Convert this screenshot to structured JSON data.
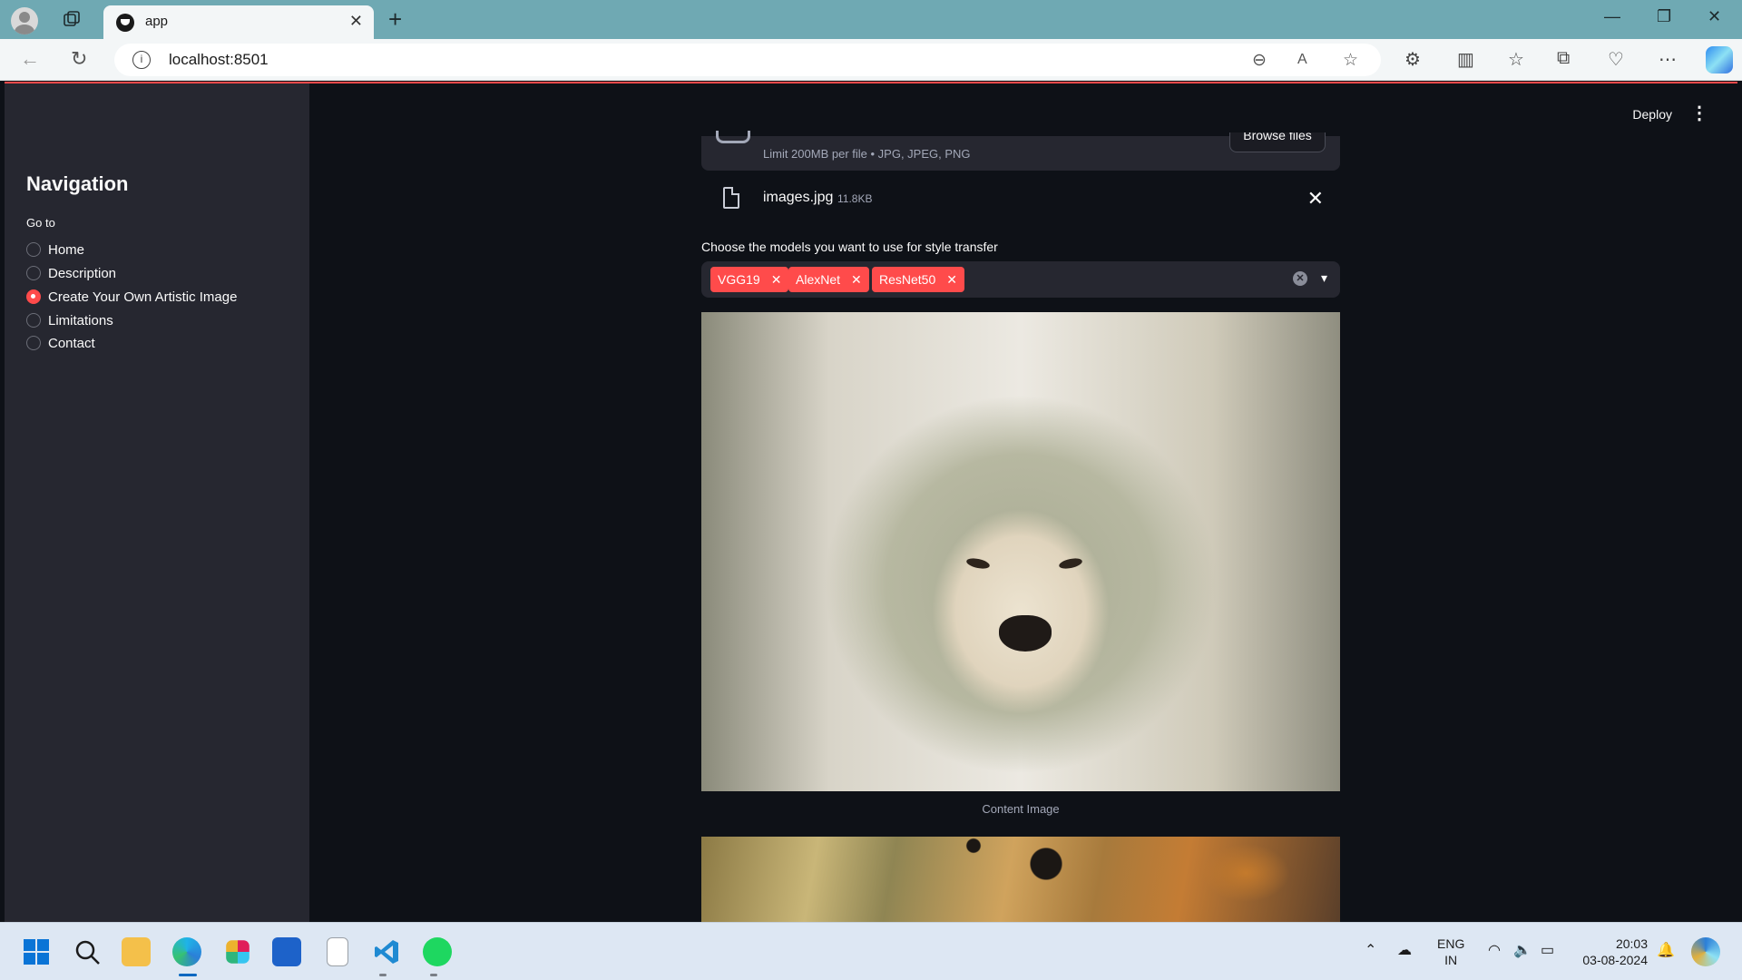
{
  "browser": {
    "tab_title": "app",
    "url": "localhost:8501"
  },
  "sidebar": {
    "title": "Navigation",
    "radio_label": "Go to",
    "options": [
      {
        "label": "Home",
        "selected": false
      },
      {
        "label": "Description",
        "selected": false
      },
      {
        "label": "Create Your Own Artistic Image",
        "selected": true
      },
      {
        "label": "Limitations",
        "selected": false
      },
      {
        "label": "Contact",
        "selected": false
      }
    ]
  },
  "header": {
    "deploy_label": "Deploy",
    "menu_glyph": "⋮"
  },
  "uploader": {
    "limit_text": "Limit 200MB per file • JPG, JPEG, PNG",
    "browse_label": "Browse files",
    "file_name": "images.jpg",
    "file_size": "11.8KB"
  },
  "models": {
    "label": "Choose the models you want to use for style transfer",
    "selected": [
      "VGG19",
      "AlexNet",
      "ResNet50"
    ]
  },
  "content_image": {
    "caption": "Content Image"
  },
  "taskbar": {
    "lang_top": "ENG",
    "lang_bottom": "IN",
    "time": "20:03",
    "date": "03-08-2024"
  },
  "colors": {
    "accent": "#ff4b4b",
    "app_bg": "#0e1117",
    "sidebar_bg": "#262730"
  }
}
